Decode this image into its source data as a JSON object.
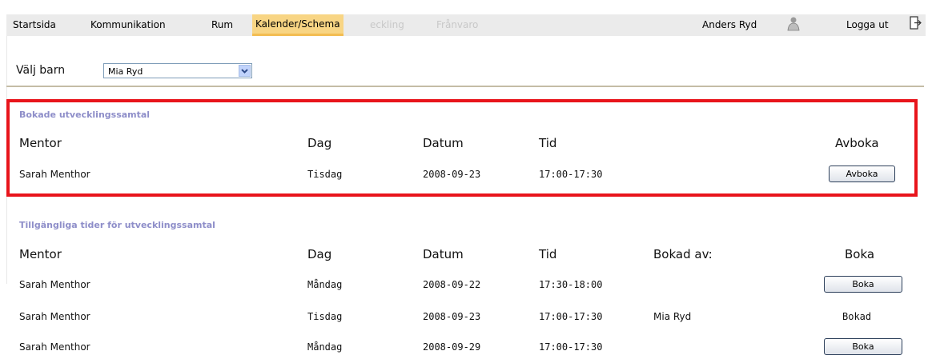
{
  "nav": {
    "items": [
      "Startsida",
      "Kommunikation",
      "Rum",
      "Kalender/Schema",
      "eckling",
      "Frånvaro"
    ],
    "user": "Anders Ryd",
    "logout": "Logga ut"
  },
  "child_select": {
    "label": "Välj barn",
    "value": "Mia Ryd"
  },
  "booked": {
    "title": "Bokade utvecklingssamtal",
    "headers": [
      "Mentor",
      "Dag",
      "Datum",
      "Tid",
      "Avboka"
    ],
    "rows": [
      {
        "mentor": "Sarah Menthor",
        "dag": "Tisdag",
        "datum": "2008-09-23",
        "tid": "17:00-17:30",
        "action": "Avboka"
      }
    ]
  },
  "available": {
    "title": "Tillgängliga tider för utvecklingssamtal",
    "headers": [
      "Mentor",
      "Dag",
      "Datum",
      "Tid",
      "Bokad av:",
      "Boka"
    ],
    "rows": [
      {
        "mentor": "Sarah Menthor",
        "dag": "Måndag",
        "datum": "2008-09-22",
        "tid": "17:30-18:00",
        "bokad_av": "",
        "action": "Boka"
      },
      {
        "mentor": "Sarah Menthor",
        "dag": "Tisdag",
        "datum": "2008-09-23",
        "tid": "17:00-17:30",
        "bokad_av": "Mia Ryd",
        "action": "Bokad"
      },
      {
        "mentor": "Sarah Menthor",
        "dag": "Måndag",
        "datum": "2008-09-29",
        "tid": "17:00-17:30",
        "bokad_av": "",
        "action": "Boka"
      }
    ]
  },
  "colors": {
    "active_tab": "#f8d584",
    "highlight_border": "#e8141b",
    "section_title": "#8e8ec9"
  },
  "icons": [
    "user-icon",
    "logout-icon",
    "dropdown-arrow-icon"
  ]
}
